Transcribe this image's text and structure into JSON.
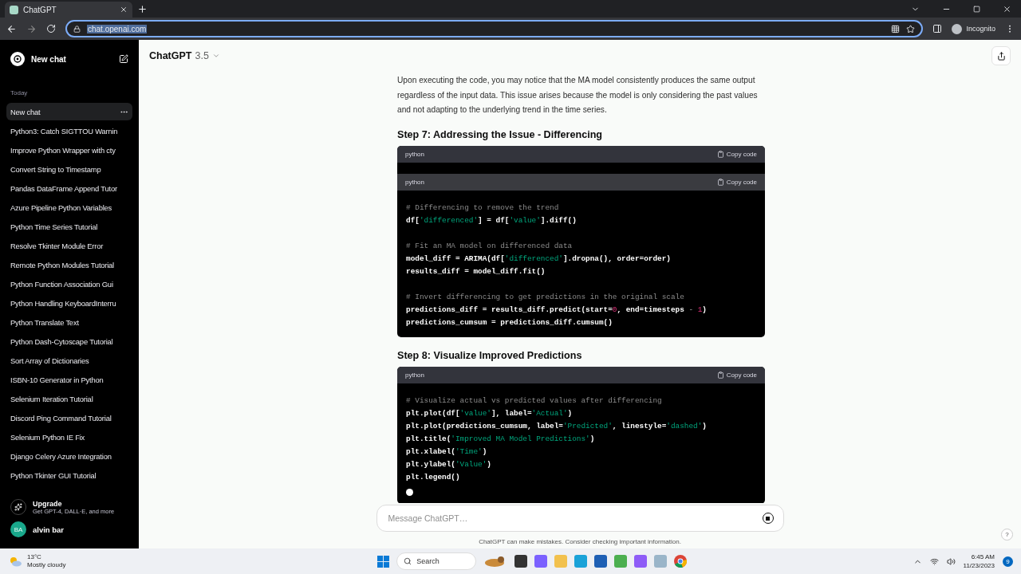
{
  "browser": {
    "tab_title": "ChatGPT",
    "url": "chat.openai.com",
    "url_selected": true,
    "profile": "Incognito"
  },
  "sidebar": {
    "new_chat": "New chat",
    "section": "Today",
    "items": [
      {
        "label": "New chat",
        "selected": true
      },
      {
        "label": "Python3: Catch SIGTTOU Warnin",
        "selected": false
      },
      {
        "label": "Improve Python Wrapper with cty",
        "selected": false
      },
      {
        "label": "Convert String to Timestamp",
        "selected": false
      },
      {
        "label": "Pandas DataFrame Append Tutor",
        "selected": false
      },
      {
        "label": "Azure Pipeline Python Variables",
        "selected": false
      },
      {
        "label": "Python Time Series Tutorial",
        "selected": false
      },
      {
        "label": "Resolve Tkinter Module Error",
        "selected": false
      },
      {
        "label": "Remote Python Modules Tutorial",
        "selected": false
      },
      {
        "label": "Python Function Association Gui",
        "selected": false
      },
      {
        "label": "Python Handling KeyboardInterru",
        "selected": false
      },
      {
        "label": "Python Translate Text",
        "selected": false
      },
      {
        "label": "Python Dash-Cytoscape Tutorial",
        "selected": false
      },
      {
        "label": "Sort Array of Dictionaries",
        "selected": false
      },
      {
        "label": "ISBN-10 Generator in Python",
        "selected": false
      },
      {
        "label": "Selenium Iteration Tutorial",
        "selected": false
      },
      {
        "label": "Discord Ping Command Tutorial",
        "selected": false
      },
      {
        "label": "Selenium Python IE Fix",
        "selected": false
      },
      {
        "label": "Django Celery Azure Integration",
        "selected": false
      },
      {
        "label": "Python Tkinter GUI Tutorial",
        "selected": false
      }
    ],
    "upgrade": {
      "title": "Upgrade",
      "subtitle": "Get GPT-4, DALL·E, and more"
    },
    "user": {
      "initials": "BA",
      "name": "alvin bar"
    }
  },
  "header": {
    "model": "ChatGPT",
    "version": "3.5"
  },
  "content": [
    {
      "kind": "paragraph",
      "text": "Upon executing the code, you may notice that the MA model consistently produces the same output regardless of the input data. This issue arises because the model is only considering the past values and not adapting to the underlying trend in the time series."
    },
    {
      "kind": "heading",
      "text": "Step 7: Addressing the Issue - Differencing"
    },
    {
      "kind": "code",
      "language": "python",
      "copy_label": "Copy code",
      "sticky_header": {
        "language": "python",
        "copy_label": "Copy code"
      },
      "streaming": false,
      "groups": [
        [
          [
            {
              "kind": "comment",
              "text": "# Differencing to remove the trend"
            }
          ],
          [
            {
              "kind": "plain",
              "text": "df["
            },
            {
              "kind": "string",
              "text": "'differenced'"
            },
            {
              "kind": "plain",
              "text": "] = df["
            },
            {
              "kind": "string",
              "text": "'value'"
            },
            {
              "kind": "plain",
              "text": "].diff()"
            }
          ]
        ],
        [
          [
            {
              "kind": "comment",
              "text": "# Fit an MA model on differenced data"
            }
          ],
          [
            {
              "kind": "plain",
              "text": "model_diff = ARIMA(df["
            },
            {
              "kind": "string",
              "text": "'differenced'"
            },
            {
              "kind": "plain",
              "text": "].dropna(), order=order)"
            }
          ],
          [
            {
              "kind": "plain",
              "text": "results_diff = model_diff.fit()"
            }
          ]
        ],
        [
          [
            {
              "kind": "comment",
              "text": "# Invert differencing to get predictions in the original scale"
            }
          ],
          [
            {
              "kind": "plain",
              "text": "predictions_diff = results_diff.predict(start="
            },
            {
              "kind": "number",
              "text": "0"
            },
            {
              "kind": "plain",
              "text": ", end=timesteps "
            },
            {
              "kind": "operator",
              "text": "- "
            },
            {
              "kind": "number",
              "text": "1"
            },
            {
              "kind": "plain",
              "text": ")"
            }
          ],
          [
            {
              "kind": "plain",
              "text": "predictions_cumsum = predictions_diff.cumsum()"
            }
          ]
        ]
      ]
    },
    {
      "kind": "heading",
      "text": "Step 8: Visualize Improved Predictions"
    },
    {
      "kind": "code",
      "language": "python",
      "copy_label": "Copy code",
      "streaming": true,
      "groups": [
        [
          [
            {
              "kind": "comment",
              "text": "# Visualize actual vs predicted values after differencing"
            }
          ],
          [
            {
              "kind": "plain",
              "text": "plt.plot(df["
            },
            {
              "kind": "string",
              "text": "'value'"
            },
            {
              "kind": "plain",
              "text": "], label="
            },
            {
              "kind": "string",
              "text": "'Actual'"
            },
            {
              "kind": "plain",
              "text": ")"
            }
          ],
          [
            {
              "kind": "plain",
              "text": "plt.plot(predictions_cumsum, label="
            },
            {
              "kind": "string",
              "text": "'Predicted'"
            },
            {
              "kind": "plain",
              "text": ", linestyle="
            },
            {
              "kind": "string",
              "text": "'dashed'"
            },
            {
              "kind": "plain",
              "text": ")"
            }
          ],
          [
            {
              "kind": "plain",
              "text": "plt.title("
            },
            {
              "kind": "string",
              "text": "'Improved MA Model Predictions'"
            },
            {
              "kind": "plain",
              "text": ")"
            }
          ],
          [
            {
              "kind": "plain",
              "text": "plt.xlabel("
            },
            {
              "kind": "string",
              "text": "'Time'"
            },
            {
              "kind": "plain",
              "text": ")"
            }
          ],
          [
            {
              "kind": "plain",
              "text": "plt.ylabel("
            },
            {
              "kind": "string",
              "text": "'Value'"
            },
            {
              "kind": "plain",
              "text": ")"
            }
          ],
          [
            {
              "kind": "plain",
              "text": "plt.legend()"
            }
          ]
        ]
      ]
    }
  ],
  "composer": {
    "placeholder": "Message ChatGPT…",
    "generating": true
  },
  "disclaimer": "ChatGPT can make mistakes. Consider checking important information.",
  "help": "?",
  "taskbar": {
    "weather": {
      "temp": "13°C",
      "text": "Mostly cloudy"
    },
    "search": "Search",
    "time": "6:45 AM",
    "date": "11/23/2023",
    "badge": "9"
  }
}
